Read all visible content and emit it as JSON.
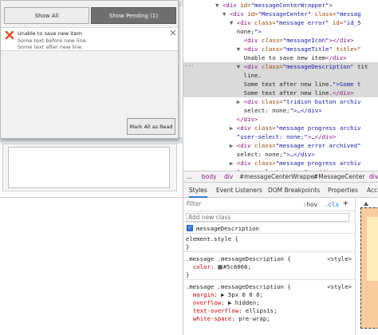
{
  "app": {
    "message_center": {
      "tabs": {
        "show_all": "Show All",
        "show_pending": "Show Pending (1)"
      },
      "message": {
        "title": "Unable to save new item",
        "description_line1": "Some text before new line.",
        "description_line2": "Some text after new line."
      },
      "mark_all_read_label": "Mark All as Read"
    }
  },
  "devtools": {
    "elements_lines": [
      {
        "indent": "  ",
        "tri": "▼",
        "html": "<div id=\"messageCenterWrapper\">"
      },
      {
        "indent": "    ",
        "tri": "▼",
        "html": "<div id=\"MessageCenter\" class=\"messag"
      },
      {
        "indent": "      ",
        "tri": "▼",
        "html": "<div class=\"message error\" id=\"id_5"
      },
      {
        "indent": "      ",
        "tri": "",
        "html": "none;\">"
      },
      {
        "indent": "        ",
        "tri": "",
        "html": "<div class=\"messageIcon\"></div>"
      },
      {
        "indent": "        ",
        "tri": "▼",
        "html": "<div class=\"messageTitle\" title=\""
      },
      {
        "indent": "        ",
        "tri": "",
        "html": "Unable to save new item</div>"
      },
      {
        "indent": "        ",
        "tri": "▼",
        "html": "<div class=\"messageDescription\" tit"
      },
      {
        "indent": "        ",
        "tri": "",
        "html": "line."
      },
      {
        "indent": "        ",
        "tri": "",
        "html": "Some text after new line.\">Some t"
      },
      {
        "indent": "        ",
        "tri": "",
        "html": "Some text after new line.</div> =="
      },
      {
        "indent": "        ",
        "tri": "▶",
        "html": "<div class=\"tridion button archiv"
      },
      {
        "indent": "        ",
        "tri": "",
        "html": "select: none;\">…</div>"
      },
      {
        "indent": "      ",
        "tri": "",
        "html": "</div>"
      },
      {
        "indent": "      ",
        "tri": "▶",
        "html": "<div class=\"message progress archiv"
      },
      {
        "indent": "      ",
        "tri": "",
        "html": "\"user-select: none;\">…</div>"
      },
      {
        "indent": "      ",
        "tri": "▶",
        "html": "<div class=\"message error archived\""
      },
      {
        "indent": "      ",
        "tri": "",
        "html": "select: none;\">…</div>"
      },
      {
        "indent": "      ",
        "tri": "▶",
        "html": "<div class=\"message progress archiv"
      },
      {
        "indent": "      ",
        "tri": "",
        "html": "\"user-select: none;\">…</div>"
      }
    ],
    "dots": "...",
    "breadcrumb": {
      "ellipsis": "…",
      "items": [
        "body",
        "div",
        "#messageCenterWrapper",
        "#MessageCenter",
        "div"
      ]
    },
    "tabs": [
      "Styles",
      "Event Listeners",
      "DOM Breakpoints",
      "Properties",
      "Acc"
    ],
    "styles": {
      "filter_placeholder": "Filter",
      "hov_label": ":hov",
      "cls_label": ".cls",
      "add_class_placeholder": "Add new class",
      "class_name": "messageDescription",
      "element_style": "element.style {",
      "element_style_close": "}",
      "rule1": {
        "selector": ".message .messageDescription {",
        "source": "<style>",
        "prop": "color",
        "value": "#5c6066;",
        "color": "#5c6066",
        "close": "}"
      },
      "rule2": {
        "selector": ".message .messageDescription {",
        "source": "<style>",
        "props": [
          {
            "prop": "margin",
            "value": "▶ 5px 0 0 0;"
          },
          {
            "prop": "overflow",
            "value": "▶ hidden;"
          },
          {
            "prop": "text-overflow",
            "value": "ellipsis;"
          },
          {
            "prop": "white-space",
            "value": "pre-wrap;"
          }
        ]
      }
    }
  }
}
